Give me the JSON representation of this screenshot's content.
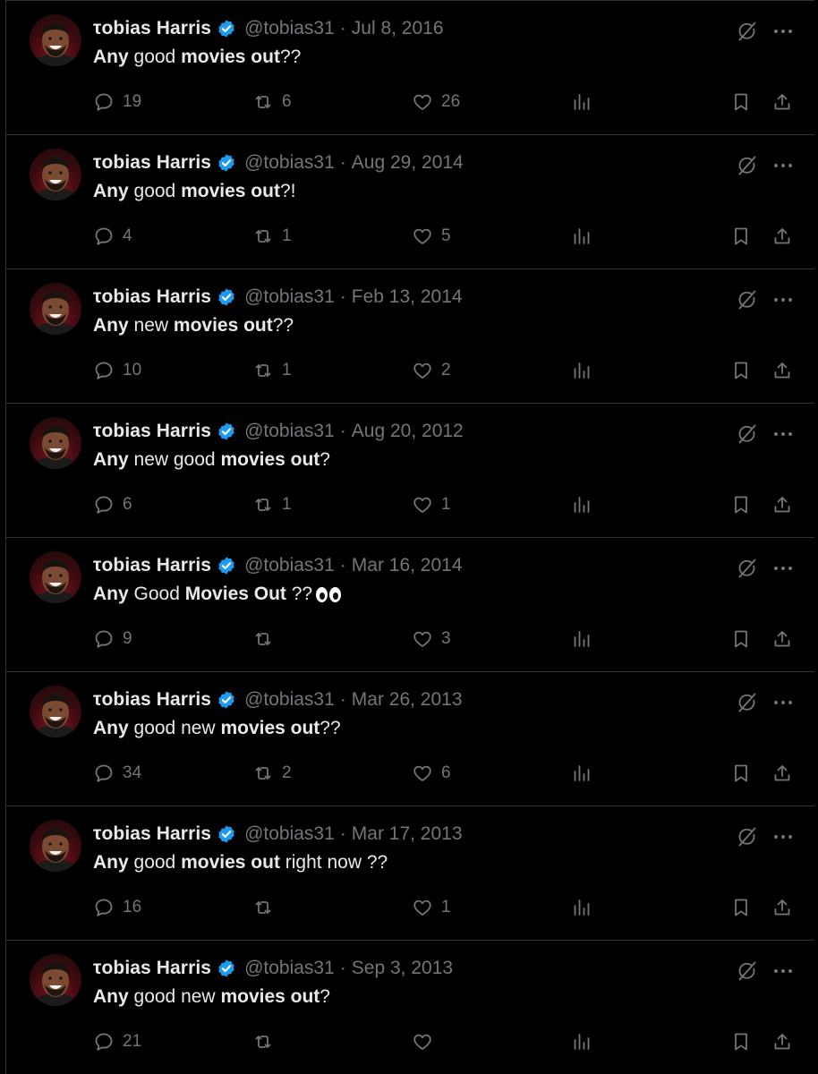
{
  "author": {
    "name": "τobias Harris",
    "handle": "@tobias31",
    "verified": true
  },
  "colors": {
    "background": "#000000",
    "text_primary": "#e7e9ea",
    "text_secondary": "#71767b",
    "divider": "#2f3336",
    "verified_badge": "#1d9bf0"
  },
  "icons": {
    "reply": "reply-bubble-icon",
    "retweet": "retweet-icon",
    "like": "heart-icon",
    "views": "views-bar-icon",
    "bookmark": "bookmark-icon",
    "share": "share-icon",
    "grok": "grok-icon",
    "more": "more-dots-icon"
  },
  "tweets": [
    {
      "date": "Jul 8, 2016",
      "text_segments": [
        {
          "t": "Any",
          "b": true
        },
        {
          "t": " good ",
          "b": false
        },
        {
          "t": "movies out",
          "b": true
        },
        {
          "t": "??",
          "b": false
        }
      ],
      "replies": "19",
      "retweets": "6",
      "likes": "26"
    },
    {
      "date": "Aug 29, 2014",
      "text_segments": [
        {
          "t": "Any",
          "b": true
        },
        {
          "t": " good ",
          "b": false
        },
        {
          "t": "movies out",
          "b": true
        },
        {
          "t": "?!",
          "b": false
        }
      ],
      "replies": "4",
      "retweets": "1",
      "likes": "5"
    },
    {
      "date": "Feb 13, 2014",
      "text_segments": [
        {
          "t": "Any",
          "b": true
        },
        {
          "t": " new ",
          "b": false
        },
        {
          "t": "movies out",
          "b": true
        },
        {
          "t": "??",
          "b": false
        }
      ],
      "replies": "10",
      "retweets": "1",
      "likes": "2"
    },
    {
      "date": "Aug 20, 2012",
      "text_segments": [
        {
          "t": "Any",
          "b": true
        },
        {
          "t": " new good ",
          "b": false
        },
        {
          "t": "movies out",
          "b": true
        },
        {
          "t": "?",
          "b": false
        }
      ],
      "replies": "6",
      "retweets": "1",
      "likes": "1"
    },
    {
      "date": "Mar 16, 2014",
      "text_segments": [
        {
          "t": "Any",
          "b": true
        },
        {
          "t": " Good ",
          "b": false
        },
        {
          "t": "Movies Out",
          "b": true
        },
        {
          "t": " ??",
          "b": false
        }
      ],
      "emoji": "eyes",
      "replies": "9",
      "retweets": "",
      "likes": "3"
    },
    {
      "date": "Mar 26, 2013",
      "text_segments": [
        {
          "t": "Any",
          "b": true
        },
        {
          "t": " good new ",
          "b": false
        },
        {
          "t": "movies out",
          "b": true
        },
        {
          "t": "??",
          "b": false
        }
      ],
      "replies": "34",
      "retweets": "2",
      "likes": "6"
    },
    {
      "date": "Mar 17, 2013",
      "text_segments": [
        {
          "t": "Any",
          "b": true
        },
        {
          "t": " good ",
          "b": false
        },
        {
          "t": "movies out",
          "b": true
        },
        {
          "t": " right now ??",
          "b": false
        }
      ],
      "replies": "16",
      "retweets": "",
      "likes": "1"
    },
    {
      "date": "Sep 3, 2013",
      "text_segments": [
        {
          "t": "Any",
          "b": true
        },
        {
          "t": " good new ",
          "b": false
        },
        {
          "t": "movies out",
          "b": true
        },
        {
          "t": "?",
          "b": false
        }
      ],
      "replies": "21",
      "retweets": "",
      "likes": ""
    }
  ]
}
